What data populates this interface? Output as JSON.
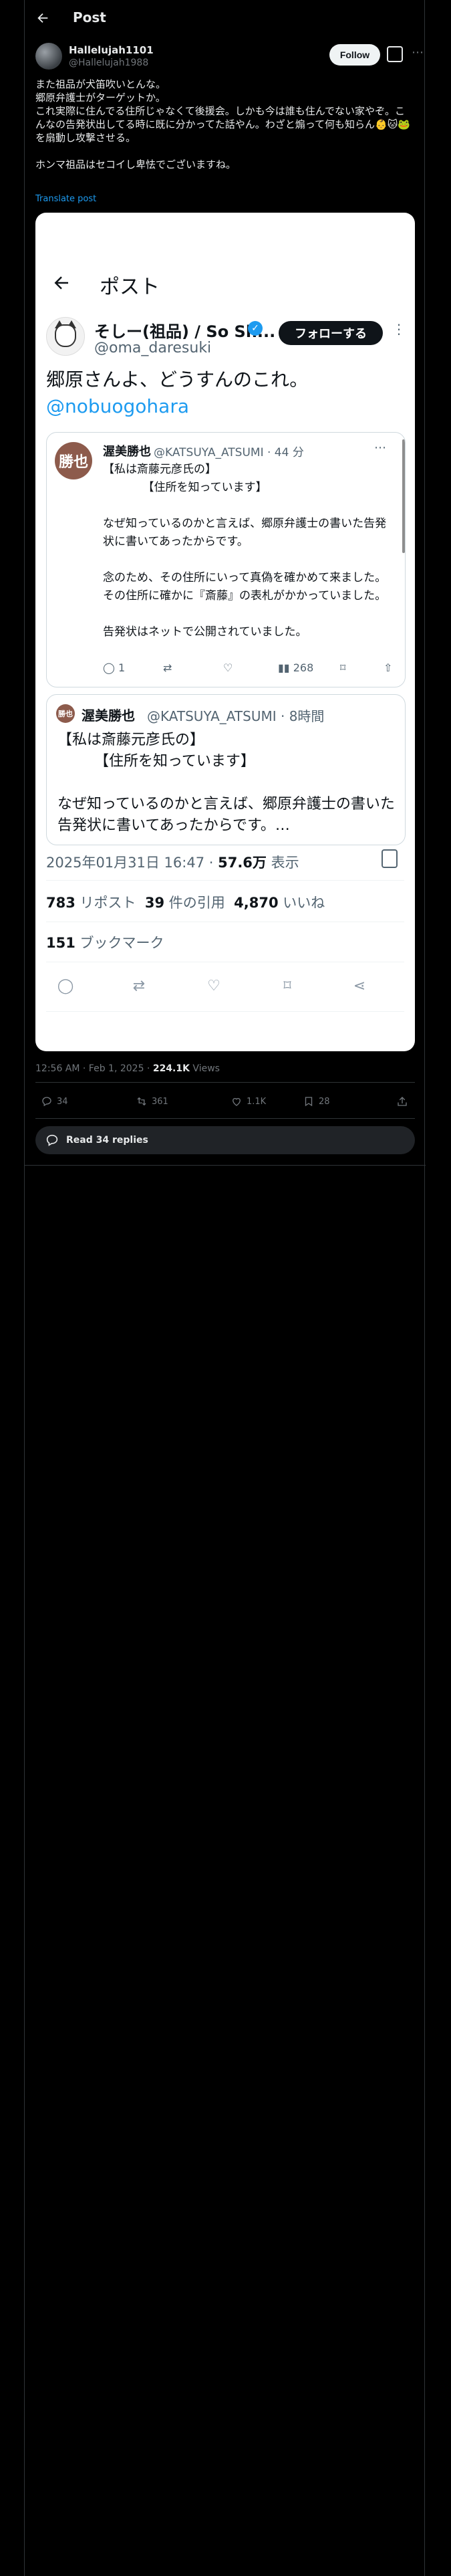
{
  "header": {
    "title": "Post"
  },
  "author": {
    "name": "Hallelujah1101",
    "handle": "@Hallelujah1988",
    "follow_label": "Follow"
  },
  "tweet": {
    "lines": [
      "また祖品が犬笛吹いとんな。",
      "郷原弁護士がターゲットか。",
      "これ実際に住んでる住所じゃなくて後援会。しかも今は誰も住んでない家やぞ。こんなの告発状出してる時に既に分かってた話やん。わざと煽って何も知らん👶🐱🐸を扇動し攻撃させる。",
      "",
      "ホンマ祖品はセコイし卑怯でございますね。"
    ],
    "translate": "Translate post"
  },
  "embedded": {
    "screen_title": "ポスト",
    "name": "そしー(祖品) / So Sh...",
    "handle": "@oma_daresuki",
    "follow_label": "フォローする",
    "text": "郷原さんよ、どうすんのこれ。",
    "link": "@nobuogohara",
    "quote1": {
      "avatar_text": "勝也",
      "name": "渥美勝也",
      "meta": "@KATSUYA_ATSUMI · 44 分",
      "lines": [
        "【私は斎藤元彦氏の】",
        "　　　　【住所を知っています】",
        "",
        "なぜ知っているのかと言えば、郷原弁護士の書いた告発状に書いてあったからです。",
        "",
        "念のため、その住所にいって真偽を確かめて来ました。",
        "その住所に確かに『斎藤』の表札がかかっていました。",
        "",
        "告発状はネットで公開されていました。"
      ],
      "reply_count": "1",
      "views": "268"
    },
    "quote2": {
      "avatar_text": "勝也",
      "name": "渥美勝也",
      "meta": "@KATSUYA_ATSUMI · 8時間",
      "lines": [
        "【私は斎藤元彦氏の】",
        "　　　【住所を知っています】",
        "",
        "なぜ知っているのかと言えば、郷原弁護士の書いた告発状に書いてあったからです。…"
      ]
    },
    "timestamp": "2025年01月31日 16:47 · ",
    "views_count": "57.6万",
    "views_label": " 表示",
    "reposts": "783",
    "reposts_label": " リポスト  ",
    "quotes": "39",
    "quotes_label": " 件の引用  ",
    "likes": "4,870",
    "likes_label": " いいね",
    "bookmarks": "151",
    "bookmarks_label": " ブックマーク"
  },
  "meta": {
    "time": "12:56 AM · Feb 1, 2025 · ",
    "views": "224.1K",
    "views_label": " Views"
  },
  "actions": {
    "replies": "34",
    "reposts": "361",
    "likes": "1.1K",
    "bookmarks": "28"
  },
  "read_replies": "Read 34 replies"
}
